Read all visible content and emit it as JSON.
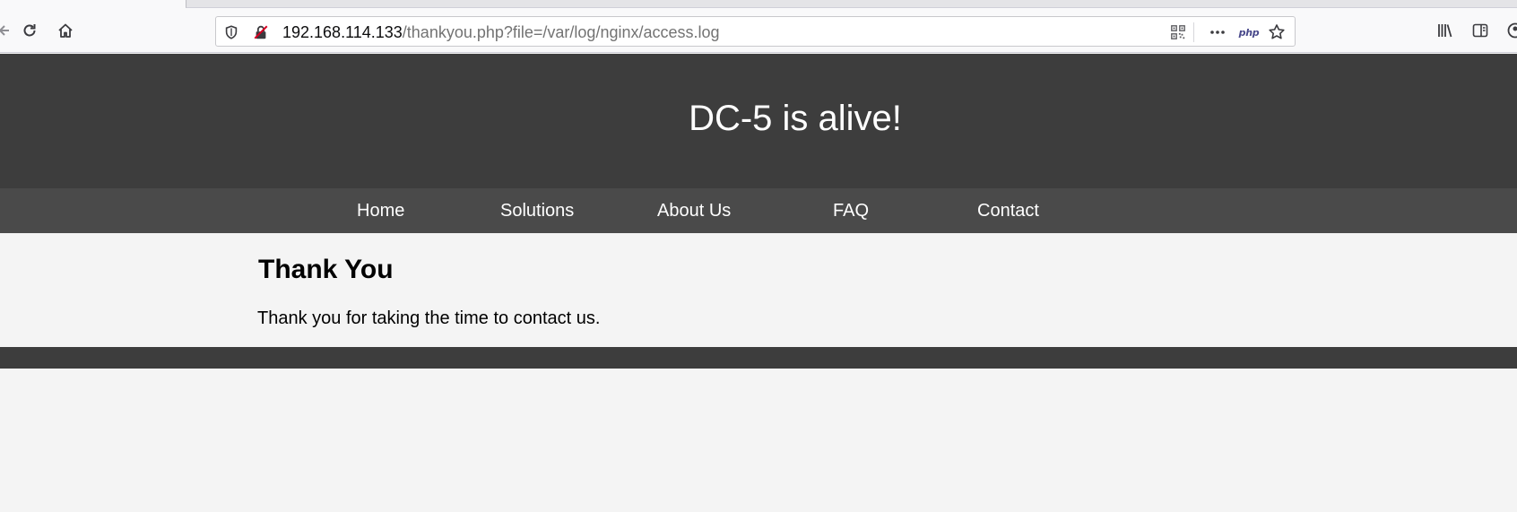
{
  "browser": {
    "url_host": "192.168.114.133",
    "url_path": "/thankyou.php?file=/var/log/nginx/access.log",
    "icons": {
      "back": "back-arrow-icon",
      "reload": "reload-icon",
      "home": "home-icon",
      "shield": "tracking-protection-shield-icon",
      "insecure": "insecure-connection-icon",
      "qr": "qr-code-icon",
      "more": "more-actions-icon",
      "php": "php",
      "bookmark": "star-icon",
      "library": "library-icon",
      "sidebar": "sidebar-icon"
    }
  },
  "site": {
    "title": "DC-5 is alive!",
    "nav": [
      "Home",
      "Solutions",
      "About Us",
      "FAQ",
      "Contact"
    ],
    "heading": "Thank You",
    "message": "Thank you for taking the time to contact us."
  },
  "colors": {
    "header_bg": "#3d3d3d",
    "nav_bg": "#4a4a4a",
    "page_bg": "#f4f4f4",
    "footer_bg": "#3d3d3d"
  }
}
